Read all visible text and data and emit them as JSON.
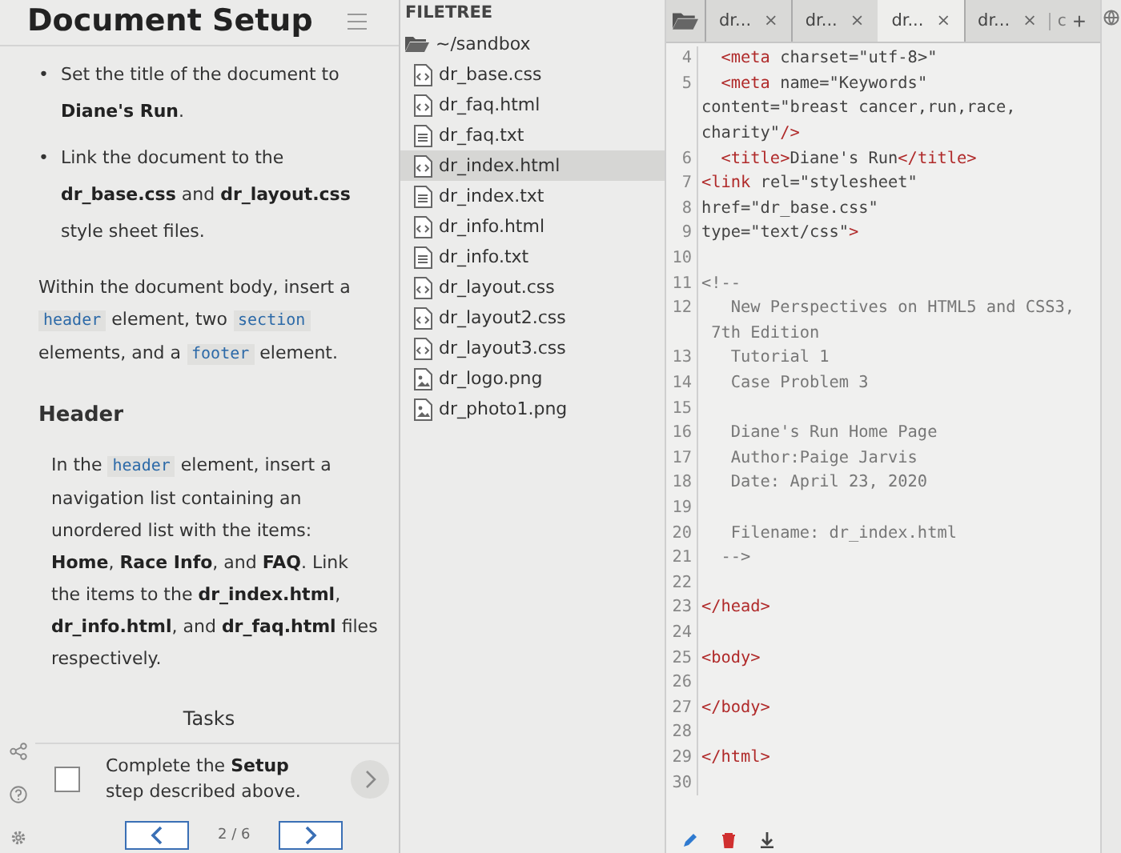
{
  "instructions": {
    "title": "Document Setup",
    "bullets": [
      {
        "marker": "•",
        "segments": [
          {
            "kind": "text",
            "text": "Set the title of the document to "
          },
          {
            "kind": "bold",
            "text": "Diane's Run"
          },
          {
            "kind": "text",
            "text": "."
          }
        ]
      },
      {
        "marker": "•",
        "segments": [
          {
            "kind": "text",
            "text": "Link the document to the "
          },
          {
            "kind": "bold",
            "text": "dr_base.css"
          },
          {
            "kind": "text",
            "text": " and "
          },
          {
            "kind": "bold",
            "text": "dr_layout.css"
          },
          {
            "kind": "text",
            "text": " style sheet files."
          }
        ]
      }
    ],
    "paragraphs": [
      {
        "kind": "para",
        "segments": [
          {
            "kind": "text",
            "text": "Within the document body, insert a "
          },
          {
            "kind": "code",
            "text": "header"
          },
          {
            "kind": "text",
            "text": " element, two "
          },
          {
            "kind": "code",
            "text": "section"
          },
          {
            "kind": "text",
            "text": " elements, and a "
          },
          {
            "kind": "code",
            "text": "footer"
          },
          {
            "kind": "text",
            "text": " element."
          }
        ]
      },
      {
        "kind": "heading",
        "segments": [
          {
            "kind": "text",
            "text": "Header"
          }
        ]
      },
      {
        "kind": "para",
        "segments": [
          {
            "kind": "text",
            "text": "In the "
          },
          {
            "kind": "code",
            "text": "header"
          },
          {
            "kind": "text",
            "text": " element, insert a navigation list containing an unordered list with the items: "
          },
          {
            "kind": "bold",
            "text": "Home"
          },
          {
            "kind": "text",
            "text": ", "
          },
          {
            "kind": "bold",
            "text": "Race Info"
          },
          {
            "kind": "text",
            "text": ", and "
          },
          {
            "kind": "bold",
            "text": "FAQ"
          },
          {
            "kind": "text",
            "text": ". Link the items to the "
          },
          {
            "kind": "bold",
            "text": "dr_index.html"
          },
          {
            "kind": "text",
            "text": ", "
          },
          {
            "kind": "bold",
            "text": "dr_info.html"
          },
          {
            "kind": "text",
            "text": ", and "
          },
          {
            "kind": "bold",
            "text": "dr_faq.html"
          },
          {
            "kind": "text",
            "text": " files respectively."
          }
        ]
      }
    ],
    "tasks_title": "Tasks",
    "tasks": [
      {
        "checked": false,
        "segments": [
          {
            "kind": "text",
            "text": "Complete the "
          },
          {
            "kind": "bold",
            "text": "Setup"
          },
          {
            "kind": "text",
            "text": " step described above."
          }
        ]
      }
    ],
    "pager": "2 / 6"
  },
  "filetree": {
    "title": "FILETREE",
    "root": "~/sandbox",
    "children": [
      {
        "name": "dr_base.css",
        "kind": "code",
        "selected": false
      },
      {
        "name": "dr_faq.html",
        "kind": "code",
        "selected": false
      },
      {
        "name": "dr_faq.txt",
        "kind": "text",
        "selected": false
      },
      {
        "name": "dr_index.html",
        "kind": "code",
        "selected": true
      },
      {
        "name": "dr_index.txt",
        "kind": "text",
        "selected": false
      },
      {
        "name": "dr_info.html",
        "kind": "code",
        "selected": false
      },
      {
        "name": "dr_info.txt",
        "kind": "text",
        "selected": false
      },
      {
        "name": "dr_layout.css",
        "kind": "code",
        "selected": false
      },
      {
        "name": "dr_layout2.css",
        "kind": "code",
        "selected": false
      },
      {
        "name": "dr_layout3.css",
        "kind": "code",
        "selected": false
      },
      {
        "name": "dr_logo.png",
        "kind": "image",
        "selected": false
      },
      {
        "name": "dr_photo1.png",
        "kind": "image",
        "selected": false
      }
    ]
  },
  "editor": {
    "tabs": [
      {
        "label": "dr...",
        "close": "×",
        "selected": false
      },
      {
        "label": "dr...",
        "close": "×",
        "selected": false
      },
      {
        "label": "dr...",
        "close": "×",
        "selected": true
      },
      {
        "label": "dr...",
        "close": "×",
        "selected": false
      }
    ],
    "cut_tab": "c",
    "add_tab": "+",
    "lines": [
      {
        "number": "4",
        "segments": [
          {
            "kind": "tag",
            "text": "  <meta"
          },
          {
            "kind": "text",
            "text": " charset=\"utf-8>\""
          }
        ]
      },
      {
        "number": "5",
        "segments": [
          {
            "kind": "tag",
            "text": "  <meta"
          },
          {
            "kind": "text",
            "text": " name=\"Keywords\""
          }
        ]
      },
      {
        "segments": [
          {
            "kind": "text",
            "text": "content=\"breast cancer,run,race,"
          }
        ]
      },
      {
        "segments": [
          {
            "kind": "text",
            "text": "charity\""
          },
          {
            "kind": "tag",
            "text": "/>"
          }
        ]
      },
      {
        "number": "6",
        "segments": [
          {
            "kind": "tag",
            "text": "  <title>"
          },
          {
            "kind": "text",
            "text": "Diane's Run"
          },
          {
            "kind": "tag",
            "text": "</title>"
          }
        ]
      },
      {
        "number": "7",
        "segments": [
          {
            "kind": "tag",
            "text": "<link"
          },
          {
            "kind": "text",
            "text": " rel=\"stylesheet\""
          }
        ]
      },
      {
        "number": "8",
        "segments": [
          {
            "kind": "text",
            "text": "href=\"dr_base.css\""
          }
        ]
      },
      {
        "number": "9",
        "segments": [
          {
            "kind": "text",
            "text": "type=\"text/css\""
          },
          {
            "kind": "tag",
            "text": ">"
          }
        ]
      },
      {
        "number": "10"
      },
      {
        "number": "11",
        "segments": [
          {
            "kind": "comment",
            "text": "<!--"
          }
        ]
      },
      {
        "number": "12",
        "segments": [
          {
            "kind": "comment",
            "text": "   New Perspectives on HTML5 and CSS3,"
          }
        ]
      },
      {
        "segments": [
          {
            "kind": "comment",
            "text": " 7th Edition"
          }
        ]
      },
      {
        "number": "13",
        "segments": [
          {
            "kind": "comment",
            "text": "   Tutorial 1"
          }
        ]
      },
      {
        "number": "14",
        "segments": [
          {
            "kind": "comment",
            "text": "   Case Problem 3"
          }
        ]
      },
      {
        "number": "15"
      },
      {
        "number": "16",
        "segments": [
          {
            "kind": "comment",
            "text": "   Diane's Run Home Page"
          }
        ]
      },
      {
        "number": "17",
        "segments": [
          {
            "kind": "comment",
            "text": "   Author:Paige Jarvis"
          }
        ]
      },
      {
        "number": "18",
        "segments": [
          {
            "kind": "comment",
            "text": "   Date: April 23, 2020"
          }
        ]
      },
      {
        "number": "19"
      },
      {
        "number": "20",
        "segments": [
          {
            "kind": "comment",
            "text": "   Filename: dr_index.html"
          }
        ]
      },
      {
        "number": "21",
        "segments": [
          {
            "kind": "comment",
            "text": "  -->"
          }
        ]
      },
      {
        "number": "22"
      },
      {
        "number": "23",
        "segments": [
          {
            "kind": "tag",
            "text": "</head>"
          }
        ]
      },
      {
        "number": "24"
      },
      {
        "number": "25",
        "segments": [
          {
            "kind": "tag",
            "text": "<body>"
          }
        ]
      },
      {
        "number": "26"
      },
      {
        "number": "27",
        "segments": [
          {
            "kind": "tag",
            "text": "</body>"
          }
        ]
      },
      {
        "number": "28"
      },
      {
        "number": "29",
        "segments": [
          {
            "kind": "tag",
            "text": "</html>"
          }
        ]
      },
      {
        "number": "30"
      }
    ]
  }
}
